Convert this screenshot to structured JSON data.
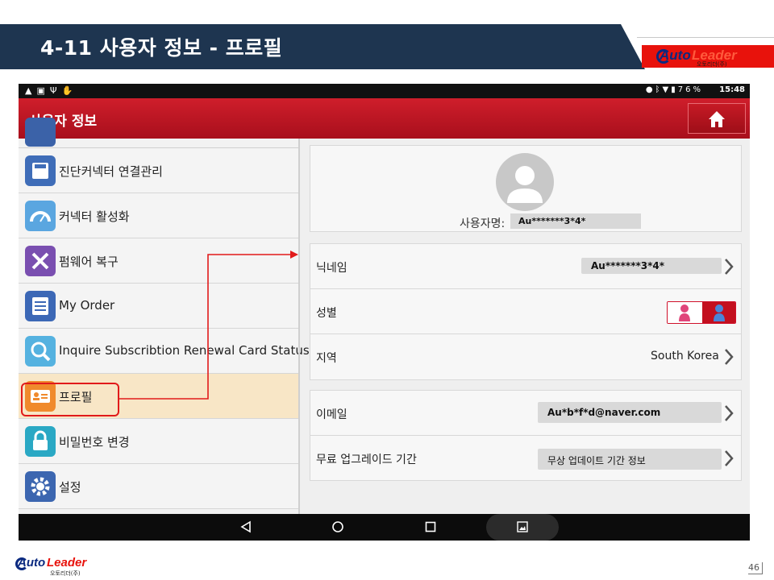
{
  "slide": {
    "title": "4-11 사용자 정보 - 프로필",
    "page_number": "46",
    "banner_color": "#1e3550"
  },
  "logo": {
    "word_a": "Auto",
    "word_b": "Leader",
    "subtitle": "오토리더(주)",
    "brand_red": "#e8120c",
    "brand_navy": "#0b2a80"
  },
  "device": {
    "status_bar": {
      "left_icons": [
        "warning-icon",
        "image-icon",
        "usb-icon",
        "hand-icon"
      ],
      "right_icons": [
        "location-icon",
        "bluetooth-icon",
        "wifi-icon",
        "battery-icon"
      ],
      "battery": "76%",
      "time": "15:48"
    },
    "app_bar": {
      "title": "사용자 정보",
      "home_icon": "home-icon",
      "accent": "#c41624"
    },
    "menu": {
      "items": [
        {
          "label": "진단커넥터 연결관리",
          "icon": "sd-card-icon",
          "active": false
        },
        {
          "label": "커넥터 활성화",
          "icon": "gauge-icon",
          "active": false
        },
        {
          "label": "펌웨어 복구",
          "icon": "tools-icon",
          "active": false
        },
        {
          "label": "My Order",
          "icon": "order-list-icon",
          "active": false
        },
        {
          "label": "Inquire Subscribtion Renewal Card Status",
          "icon": "magnifier-icon",
          "active": false
        },
        {
          "label": "프로필",
          "icon": "id-card-icon",
          "active": true
        },
        {
          "label": "비밀번호 변경",
          "icon": "lock-icon",
          "active": false
        },
        {
          "label": "설정",
          "icon": "gear-icon",
          "active": false
        }
      ],
      "active_bg": "#f8e6c6"
    },
    "profile": {
      "username_label": "사용자명:",
      "username_value": "Au*******3*4*",
      "nickname_label": "닉네임",
      "nickname_value": "Au*******3*4*",
      "gender_label": "성별",
      "gender_selected": "male",
      "region_label": "지역",
      "region_value": "South Korea",
      "email_label": "이메일",
      "email_value": "Au*b*f*d@naver.com",
      "upgrade_label": "무료 업그레이드 기간",
      "upgrade_value": "무상 업데이트 기간 정보"
    },
    "nav_bar": {
      "icons": [
        "back-icon",
        "home-circle-icon",
        "recents-icon",
        "screenshot-icon"
      ]
    }
  },
  "annotation": {
    "color": "#e11a1a"
  }
}
